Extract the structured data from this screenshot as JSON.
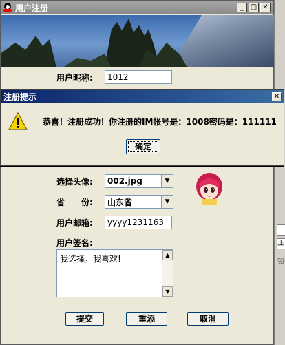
{
  "window": {
    "title": "用户注册",
    "minimize": "_",
    "maximize": "□",
    "close": "✕"
  },
  "form": {
    "nickname_label": "用户昵称:",
    "nickname_value": "1012",
    "avatar_label": "选择头像:",
    "avatar_value": "002.jpg",
    "province_label": "省　　份:",
    "province_value": "山东省",
    "email_label": "用户邮箱:",
    "email_value": "yyyy1231163",
    "signature_label": "用户签名:",
    "signature_value": "我选择，我喜欢!"
  },
  "buttons": {
    "submit": "提交",
    "reset": "重添",
    "cancel": "取消"
  },
  "dialog": {
    "title": "注册提示",
    "close": "✕",
    "message": "恭喜！注册成功！你注册的IM帐号是：1008密码是：111111",
    "ok": "确定",
    "icon": "warning-icon"
  },
  "background_fragments": [
    "正",
    "锁"
  ],
  "colors": {
    "dialog_title": "#0a246a",
    "button_border": "#003c74"
  }
}
